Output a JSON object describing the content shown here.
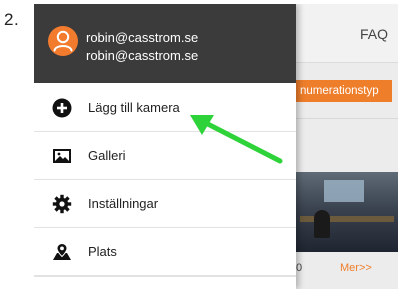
{
  "step": {
    "number": "2."
  },
  "app": {
    "header_link": "FAQ",
    "sort_button": "numerationstyp",
    "camera_caption": "0",
    "more_link": "Mer>>"
  },
  "drawer": {
    "account": {
      "email": "robin@casstrom.se",
      "name": "robin@casstrom.se"
    },
    "items": [
      {
        "label": "Lägg till kamera",
        "icon": "add-circle-icon"
      },
      {
        "label": "Galleri",
        "icon": "gallery-icon"
      },
      {
        "label": "Inställningar",
        "icon": "gear-icon"
      },
      {
        "label": "Plats",
        "icon": "map-pin-icon"
      }
    ]
  },
  "colors": {
    "accent_orange": "#ef7e2b",
    "drawer_header": "#3b3b3b",
    "annotation_arrow": "#2ed33a"
  }
}
